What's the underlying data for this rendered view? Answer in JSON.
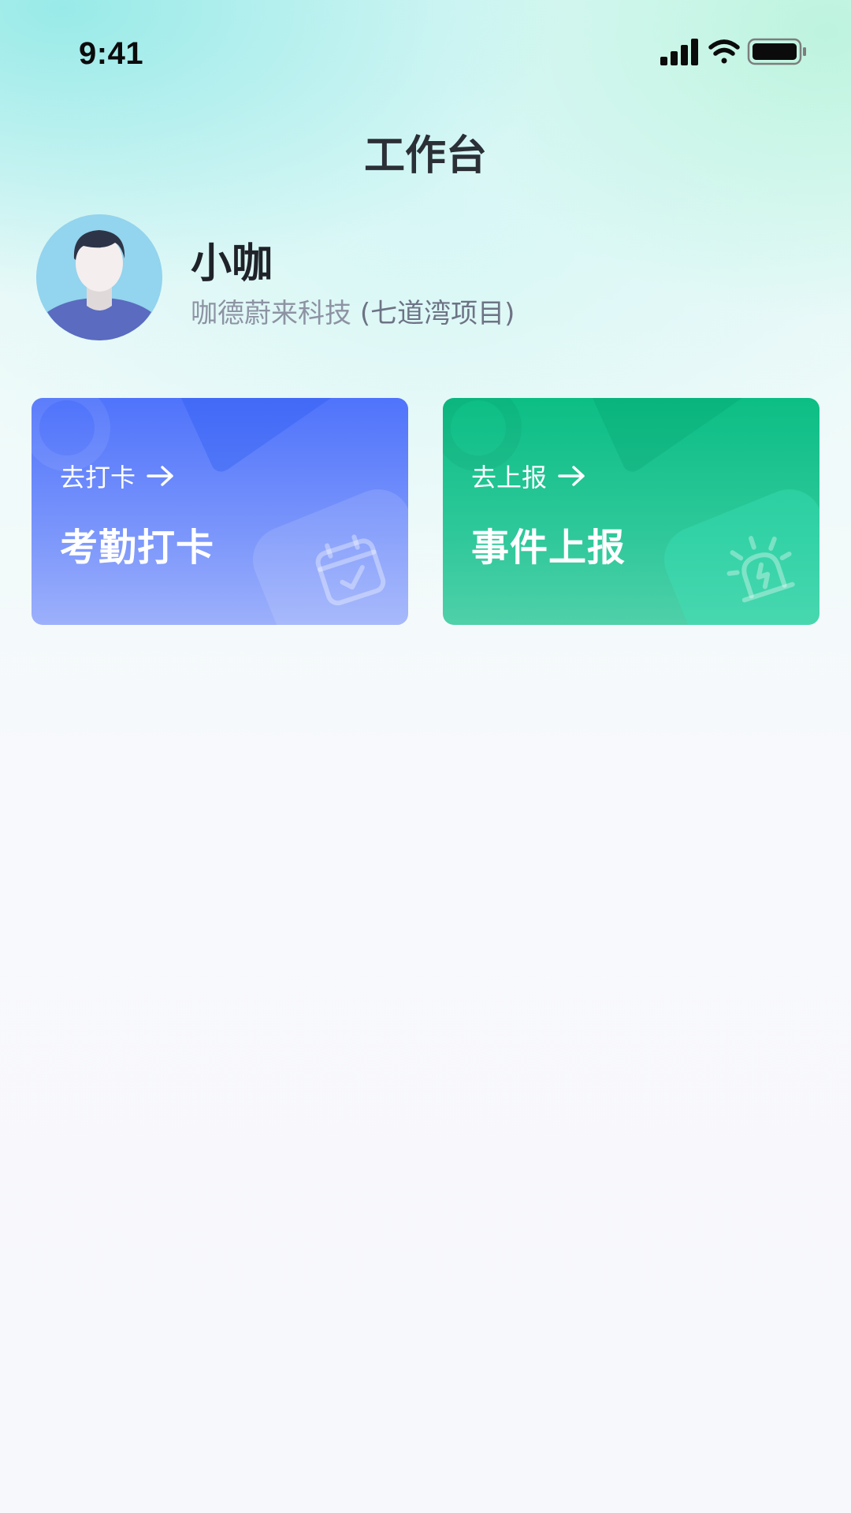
{
  "status_bar": {
    "time": "9:41",
    "icons": [
      "signal-icon",
      "wifi-icon",
      "battery-icon"
    ]
  },
  "header": {
    "title": "工作台"
  },
  "profile": {
    "name": "小咖",
    "org": "咖德蔚来科技",
    "project": "(七道湾项目)"
  },
  "cards": [
    {
      "link_label": "去打卡",
      "title": "考勤打卡",
      "icon": "calendar-check-icon",
      "color": "#5a7bfb"
    },
    {
      "link_label": "去上报",
      "title": "事件上报",
      "icon": "alarm-siren-icon",
      "color": "#1cc28f"
    }
  ]
}
